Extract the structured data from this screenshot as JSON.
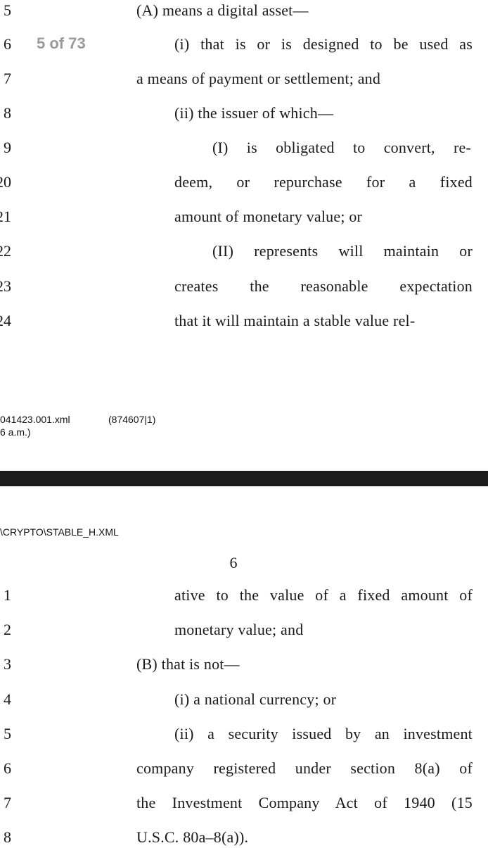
{
  "viewer": {
    "page_counter": "5 of 73"
  },
  "page_top": {
    "lines": [
      {
        "num": "5",
        "text": "(A) means a digital asset—"
      },
      {
        "num": "6",
        "text": "(i) that is or is designed to be used as"
      },
      {
        "num": "7",
        "text": "a means of payment or settlement; and"
      },
      {
        "num": "8",
        "text": "(ii) the issuer of which—"
      },
      {
        "num": "9",
        "text": "(I) is obligated to convert, re-"
      },
      {
        "num": "20",
        "text": "deem, or repurchase for a fixed"
      },
      {
        "num": "21",
        "text": "amount of monetary value; or"
      },
      {
        "num": "22",
        "text": "(II) represents will maintain or"
      },
      {
        "num": "23",
        "text": "creates the reasonable expectation"
      },
      {
        "num": "24",
        "text": "that it will maintain a stable value rel-"
      }
    ],
    "footer_file": "041423.001.xml",
    "footer_id": "(874607|1)",
    "footer_time": "6 a.m.)"
  },
  "page_bottom": {
    "header_path": "\\CRYPTO\\STABLE_H.XML",
    "page_number": "6",
    "lines": [
      {
        "num": "1",
        "text": "ative to the value of a fixed amount of"
      },
      {
        "num": "2",
        "text": "monetary value; and"
      },
      {
        "num": "3",
        "text": "(B) that is not—"
      },
      {
        "num": "4",
        "text": "(i) a national currency; or"
      },
      {
        "num": "5",
        "text": "(ii) a security issued by an investment"
      },
      {
        "num": "6",
        "text": "company registered under section 8(a) of"
      },
      {
        "num": "7",
        "text": "the Investment Company Act of 1940 (15"
      },
      {
        "num": "8",
        "text": "U.S.C. 80a–8(a))."
      }
    ]
  }
}
